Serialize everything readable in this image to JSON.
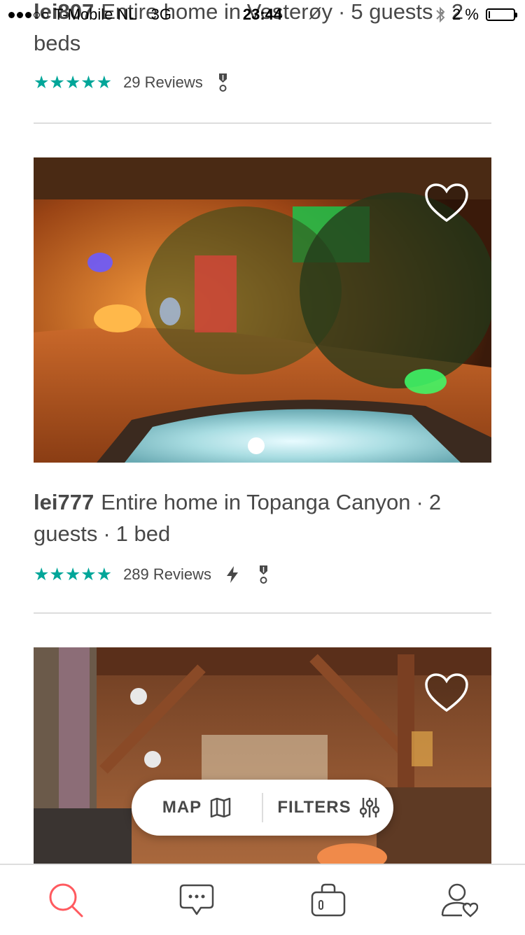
{
  "status_bar": {
    "carrier": "T-Mobile NL",
    "network": "3G",
    "time": "23:44",
    "battery": "2 %",
    "battery_level": 0.02
  },
  "listings": [
    {
      "host": "lei807",
      "description": "Entire home in Vesterøy",
      "guests": "5 guests",
      "beds": "2 beds",
      "rating_stars": 5,
      "reviews": "29 Reviews",
      "instant_book": false
    },
    {
      "host": "lei777",
      "description": "Entire home in Topanga Canyon",
      "guests": "2 guests",
      "beds": "1 bed",
      "rating_stars": 5,
      "reviews": "289 Reviews",
      "instant_book": true
    }
  ],
  "floating_bar": {
    "map_label": "MAP",
    "filters_label": "FILTERS"
  },
  "colors": {
    "accent": "#FF5A5F",
    "star": "#00A699",
    "text": "#484848",
    "divider": "#DDDDDD"
  },
  "icons": {
    "search": "search-icon",
    "messages": "messages-icon",
    "trips": "bag-icon",
    "profile": "profile-icon"
  }
}
